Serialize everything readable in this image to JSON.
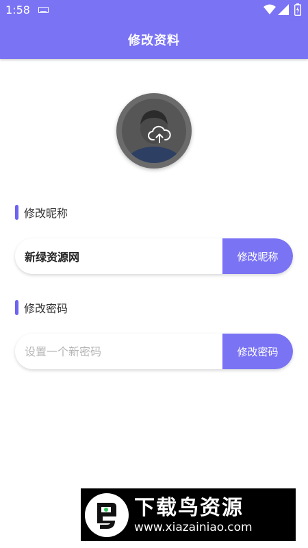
{
  "status_bar": {
    "time": "1:58"
  },
  "app_bar": {
    "title": "修改资料"
  },
  "nickname_section": {
    "title": "修改昵称",
    "input_value": "新绿资源网",
    "button_label": "修改昵称"
  },
  "password_section": {
    "title": "修改密码",
    "input_placeholder": "设置一个新密码",
    "button_label": "修改密码"
  },
  "watermark": {
    "logo_text": "下载鸟资源",
    "url": "www.xiazainiao.com"
  },
  "colors": {
    "primary": "#7a73f4",
    "accent_bar": "#6c63ee"
  },
  "icons": [
    "keyboard-icon",
    "wifi-icon",
    "signal-icon",
    "battery-icon",
    "upload-cloud-icon"
  ]
}
